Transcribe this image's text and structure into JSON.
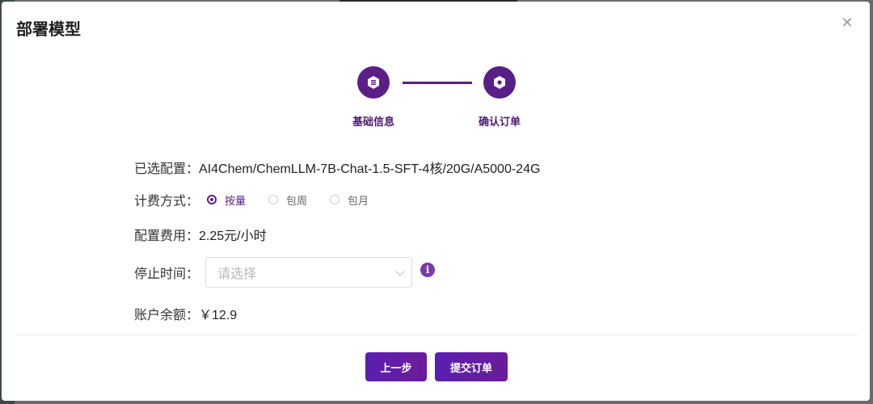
{
  "dialog": {
    "title": "部署模型",
    "close_icon": "close-icon"
  },
  "steps": [
    {
      "label": "基础信息",
      "icon": "document-icon"
    },
    {
      "label": "确认订单",
      "icon": "hexagon-icon"
    }
  ],
  "form": {
    "selected_config": {
      "label": "已选配置：",
      "value": "AI4Chem/ChemLLM-7B-Chat-1.5-SFT-4核/20G/A5000-24G"
    },
    "billing": {
      "label": "计费方式：",
      "options": [
        {
          "label": "按量",
          "checked": true
        },
        {
          "label": "包周",
          "checked": false
        },
        {
          "label": "包月",
          "checked": false
        }
      ]
    },
    "config_fee": {
      "label": "配置费用：",
      "value": "2.25元/小时"
    },
    "stop_time": {
      "label": "停止时间：",
      "placeholder": "请选择",
      "info_icon": "info-icon"
    },
    "balance": {
      "label": "账户余额：",
      "value": "￥12.9"
    }
  },
  "footer": {
    "prev_label": "上一步",
    "submit_label": "提交订单"
  },
  "colors": {
    "accent": "#5a1f86",
    "button": "#5a1fb0"
  }
}
